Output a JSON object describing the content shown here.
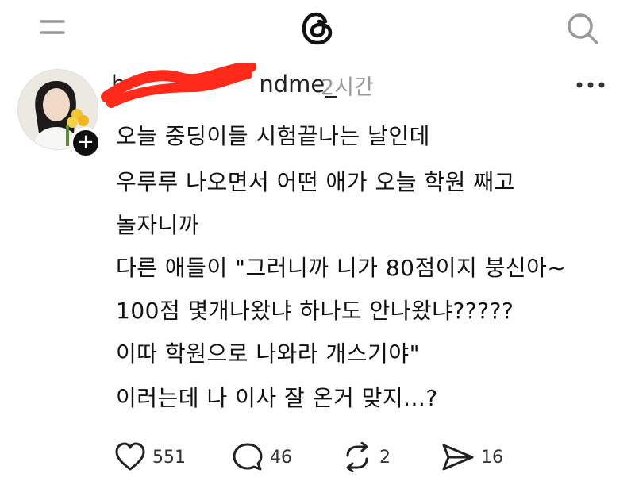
{
  "header": {
    "menu_icon": "hamburger-icon",
    "logo_icon": "threads-logo-icon",
    "search_icon": "search-icon"
  },
  "post": {
    "username_visible": "ndme_",
    "timestamp": "2시간",
    "lines": [
      "오늘 중딩이들 시험끝나는 날인데",
      "우루루 나오면서 어떤 애가 오늘 학원 째고",
      "놀자니까",
      "다른 애들이 \"그러니까 니가 80점이지 붕신아~",
      "100점 몇개나왔냐 하나도 안나왔냐?????",
      "이따 학원으로 나와라 개스기야\"",
      "이러는데 나 이사 잘 온거 맞지...?"
    ],
    "follow_label": "+"
  },
  "actions": {
    "likes": "551",
    "replies": "46",
    "reposts": "2",
    "shares": "16"
  },
  "colors": {
    "redaction": "#ff2a1a",
    "timestamp": "#999999",
    "text": "#111111"
  }
}
